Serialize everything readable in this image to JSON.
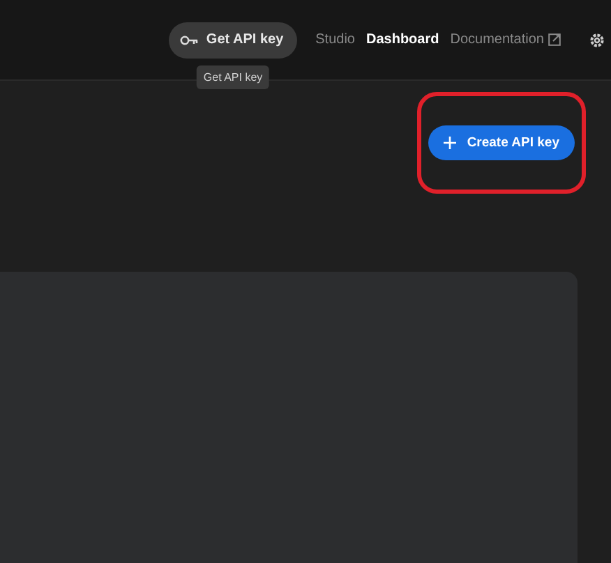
{
  "header": {
    "api_key_button": {
      "label": "Get API key"
    },
    "tooltip": "Get API key",
    "nav": [
      {
        "label": "Studio",
        "selected": false,
        "external": false
      },
      {
        "label": "Dashboard",
        "selected": true,
        "external": false
      },
      {
        "label": "Documentation",
        "selected": false,
        "external": true
      }
    ]
  },
  "actions": {
    "create_button": {
      "label": "Create API key",
      "highlighted": true
    }
  }
}
